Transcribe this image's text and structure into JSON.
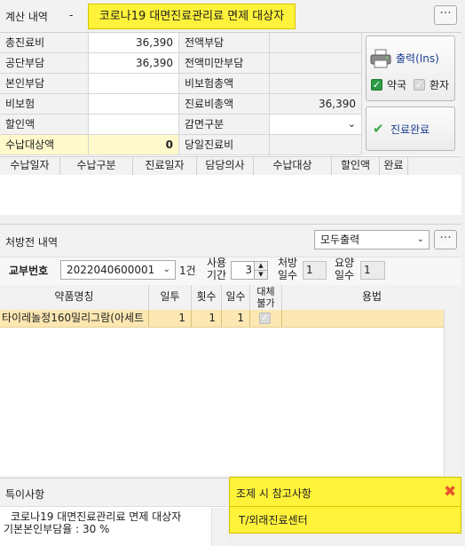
{
  "billing": {
    "section_label": "계산 내역",
    "dash": "-",
    "banner": "코로나19 대면진료관리료 면제 대상자",
    "more": "···",
    "rows": [
      {
        "l1": "총진료비",
        "v1": "36,390",
        "l2": "전액부담",
        "v2": ""
      },
      {
        "l1": "공단부담",
        "v1": "36,390",
        "l2": "전액미만부담",
        "v2": ""
      },
      {
        "l1": "본인부담",
        "v1": "",
        "l2": "비보험총액",
        "v2": ""
      },
      {
        "l1": "비보험",
        "v1": "",
        "l2": "진료비총액",
        "v2": "36,390"
      },
      {
        "l1": "할인액",
        "v1": "",
        "l2": "감면구분",
        "v2": ""
      },
      {
        "l1": "수납대상액",
        "v1": "0",
        "l2": "당일진료비",
        "v2": ""
      }
    ]
  },
  "side": {
    "print_label": "출력(Ins)",
    "pharmacy_label": "약국",
    "patient_label": "환자",
    "complete_label": "진료완료"
  },
  "payments": {
    "columns": [
      "수납일자",
      "수납구분",
      "진료일자",
      "담당의사",
      "수납대상",
      "할인액",
      "완료"
    ]
  },
  "prescription": {
    "section_label": "처방전 내역",
    "output_option": "모두출력",
    "more": "···",
    "issue_label": "교부번호",
    "issue_no": "2022040600001",
    "count": "1건",
    "usage_label_1": "사용",
    "usage_label_2": "기간",
    "usage_value": "3",
    "rx_days_label_1": "처방",
    "rx_days_label_2": "일수",
    "rx_days_value": "1",
    "care_days_label_1": "요양",
    "care_days_label_2": "일수",
    "care_days_value": "1",
    "columns": {
      "name": "약품명칭",
      "dose": "일투",
      "times": "횟수",
      "days": "일수",
      "sub_1": "대체",
      "sub_2": "불가",
      "usage": "용법"
    },
    "rows": [
      {
        "name": "타이레놀정160밀리그람(아세트",
        "dose": "1",
        "times": "1",
        "days": "1",
        "usage": ""
      }
    ]
  },
  "notes": {
    "special_label": "특이사항",
    "special_text_1": "코로나19 대면진료관리료 면제 대상자",
    "special_text_2": "기본본인부담율 : 30 %",
    "dispense_label": "조제 시 참고사항",
    "dispense_text": "T/외래진료센터"
  },
  "colors": {
    "banner_bg": "#fff23a",
    "row_highlight": "#fde7b2",
    "note_bg": "#fff23a",
    "close_icon": "#e8552c"
  }
}
